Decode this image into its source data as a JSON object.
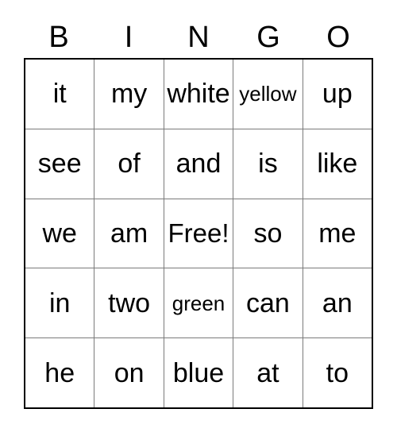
{
  "card": {
    "title": "BINGO",
    "header": [
      {
        "label": "B"
      },
      {
        "label": "I"
      },
      {
        "label": "N"
      },
      {
        "label": "G"
      },
      {
        "label": "O"
      }
    ],
    "free_space": "Free!",
    "colors": {
      "background": "#ffffff",
      "text": "#000000",
      "outer_border": "#000000",
      "inner_border": "#7a7a7a"
    },
    "rows": [
      {
        "cells": [
          {
            "text": "it",
            "size": "normal"
          },
          {
            "text": "my",
            "size": "normal"
          },
          {
            "text": "white",
            "size": "normal"
          },
          {
            "text": "yellow",
            "size": "small"
          },
          {
            "text": "up",
            "size": "normal"
          }
        ]
      },
      {
        "cells": [
          {
            "text": "see",
            "size": "normal"
          },
          {
            "text": "of",
            "size": "normal"
          },
          {
            "text": "and",
            "size": "normal"
          },
          {
            "text": "is",
            "size": "normal"
          },
          {
            "text": "like",
            "size": "normal"
          }
        ]
      },
      {
        "cells": [
          {
            "text": "we",
            "size": "normal"
          },
          {
            "text": "am",
            "size": "normal"
          },
          {
            "text": "Free!",
            "size": "free"
          },
          {
            "text": "so",
            "size": "normal"
          },
          {
            "text": "me",
            "size": "normal"
          }
        ]
      },
      {
        "cells": [
          {
            "text": "in",
            "size": "normal"
          },
          {
            "text": "two",
            "size": "normal"
          },
          {
            "text": "green",
            "size": "small"
          },
          {
            "text": "can",
            "size": "normal"
          },
          {
            "text": "an",
            "size": "normal"
          }
        ]
      },
      {
        "cells": [
          {
            "text": "he",
            "size": "normal"
          },
          {
            "text": "on",
            "size": "normal"
          },
          {
            "text": "blue",
            "size": "normal"
          },
          {
            "text": "at",
            "size": "normal"
          },
          {
            "text": "to",
            "size": "normal"
          }
        ]
      }
    ]
  }
}
